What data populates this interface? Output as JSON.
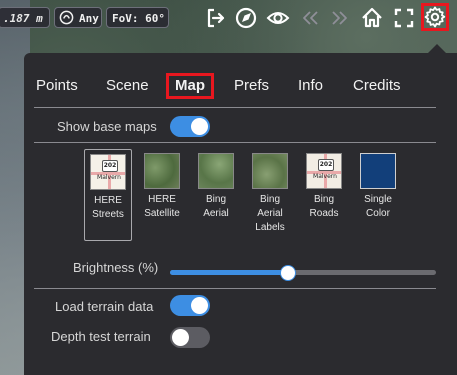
{
  "toolbar": {
    "coord_text": ".187 m",
    "any_label": "Any",
    "fov_label": "FoV: 60°",
    "icons": [
      "sign-in-icon",
      "navigate-icon",
      "eye-icon",
      "step-back-icon",
      "step-forward-icon",
      "home-icon",
      "fullscreen-icon",
      "gear-icon"
    ]
  },
  "tabs": [
    {
      "label": "Points",
      "active": false
    },
    {
      "label": "Scene",
      "active": false
    },
    {
      "label": "Map",
      "active": true
    },
    {
      "label": "Prefs",
      "active": false
    },
    {
      "label": "Info",
      "active": false
    },
    {
      "label": "Credits",
      "active": false
    }
  ],
  "map": {
    "show_base_maps_label": "Show base maps",
    "show_base_maps_on": true,
    "base_maps": [
      {
        "label": "HERE Streets",
        "selected": true
      },
      {
        "label": "HERE Satellite",
        "selected": false
      },
      {
        "label": "Bing Aerial",
        "selected": false
      },
      {
        "label": "Bing Aerial Labels",
        "selected": false
      },
      {
        "label": "Bing Roads",
        "selected": false
      },
      {
        "label": "Single Color",
        "selected": false
      }
    ],
    "thumb_shield": "202",
    "thumb_town": "Malvern",
    "brightness_label": "Brightness (%)",
    "brightness_fraction": 0.44,
    "load_terrain_label": "Load terrain data",
    "load_terrain_on": true,
    "depth_test_label": "Depth test terrain",
    "depth_test_on": false
  },
  "colors": {
    "accent": "#3d8ee3",
    "highlight": "#e8171f",
    "panel": "#2b2b2f",
    "single_color": "#123f7a"
  }
}
